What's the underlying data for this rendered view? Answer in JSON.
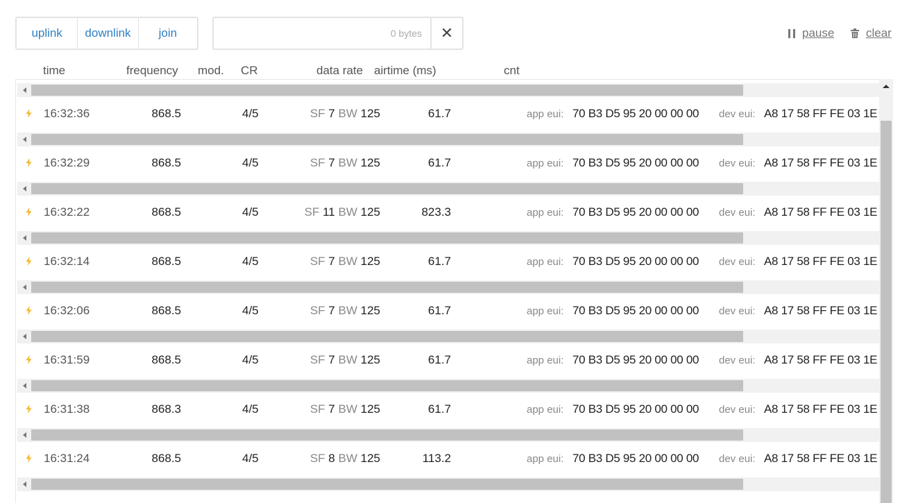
{
  "filters": {
    "uplink": "uplink",
    "downlink": "downlink",
    "join": "join"
  },
  "search": {
    "value": "",
    "placeholder": "",
    "bytes": "0 bytes",
    "clear_glyph": "✕"
  },
  "controls": {
    "pause": "pause",
    "clear": "clear"
  },
  "columns": {
    "time": "time",
    "frequency": "frequency",
    "modulation": "mod.",
    "cr": "CR",
    "data_rate": "data rate",
    "airtime": "airtime (ms)",
    "cnt": "cnt"
  },
  "labels": {
    "sf": "SF",
    "bw": "BW",
    "app_eui": "app eui:",
    "dev_eui": "dev eui:"
  },
  "colors": {
    "link": "#2f7fc1",
    "bolt": "#f5b82e",
    "scroll_thumb": "#c1c1c1"
  },
  "rows": [
    {
      "time": "16:32:36",
      "frequency": "868.5",
      "cr": "4/5",
      "sf": "7",
      "bw": "125",
      "airtime": "61.7",
      "app_eui": "70 B3 D5 95 20 00 00 00",
      "dev_eui": "A8 17 58 FF FE 03 1E"
    },
    {
      "time": "16:32:29",
      "frequency": "868.5",
      "cr": "4/5",
      "sf": "7",
      "bw": "125",
      "airtime": "61.7",
      "app_eui": "70 B3 D5 95 20 00 00 00",
      "dev_eui": "A8 17 58 FF FE 03 1E"
    },
    {
      "time": "16:32:22",
      "frequency": "868.5",
      "cr": "4/5",
      "sf": "11",
      "bw": "125",
      "airtime": "823.3",
      "app_eui": "70 B3 D5 95 20 00 00 00",
      "dev_eui": "A8 17 58 FF FE 03 1E"
    },
    {
      "time": "16:32:14",
      "frequency": "868.5",
      "cr": "4/5",
      "sf": "7",
      "bw": "125",
      "airtime": "61.7",
      "app_eui": "70 B3 D5 95 20 00 00 00",
      "dev_eui": "A8 17 58 FF FE 03 1E"
    },
    {
      "time": "16:32:06",
      "frequency": "868.5",
      "cr": "4/5",
      "sf": "7",
      "bw": "125",
      "airtime": "61.7",
      "app_eui": "70 B3 D5 95 20 00 00 00",
      "dev_eui": "A8 17 58 FF FE 03 1E"
    },
    {
      "time": "16:31:59",
      "frequency": "868.5",
      "cr": "4/5",
      "sf": "7",
      "bw": "125",
      "airtime": "61.7",
      "app_eui": "70 B3 D5 95 20 00 00 00",
      "dev_eui": "A8 17 58 FF FE 03 1E"
    },
    {
      "time": "16:31:38",
      "frequency": "868.3",
      "cr": "4/5",
      "sf": "7",
      "bw": "125",
      "airtime": "61.7",
      "app_eui": "70 B3 D5 95 20 00 00 00",
      "dev_eui": "A8 17 58 FF FE 03 1E"
    },
    {
      "time": "16:31:24",
      "frequency": "868.5",
      "cr": "4/5",
      "sf": "8",
      "bw": "125",
      "airtime": "113.2",
      "app_eui": "70 B3 D5 95 20 00 00 00",
      "dev_eui": "A8 17 58 FF FE 03 1E"
    }
  ]
}
